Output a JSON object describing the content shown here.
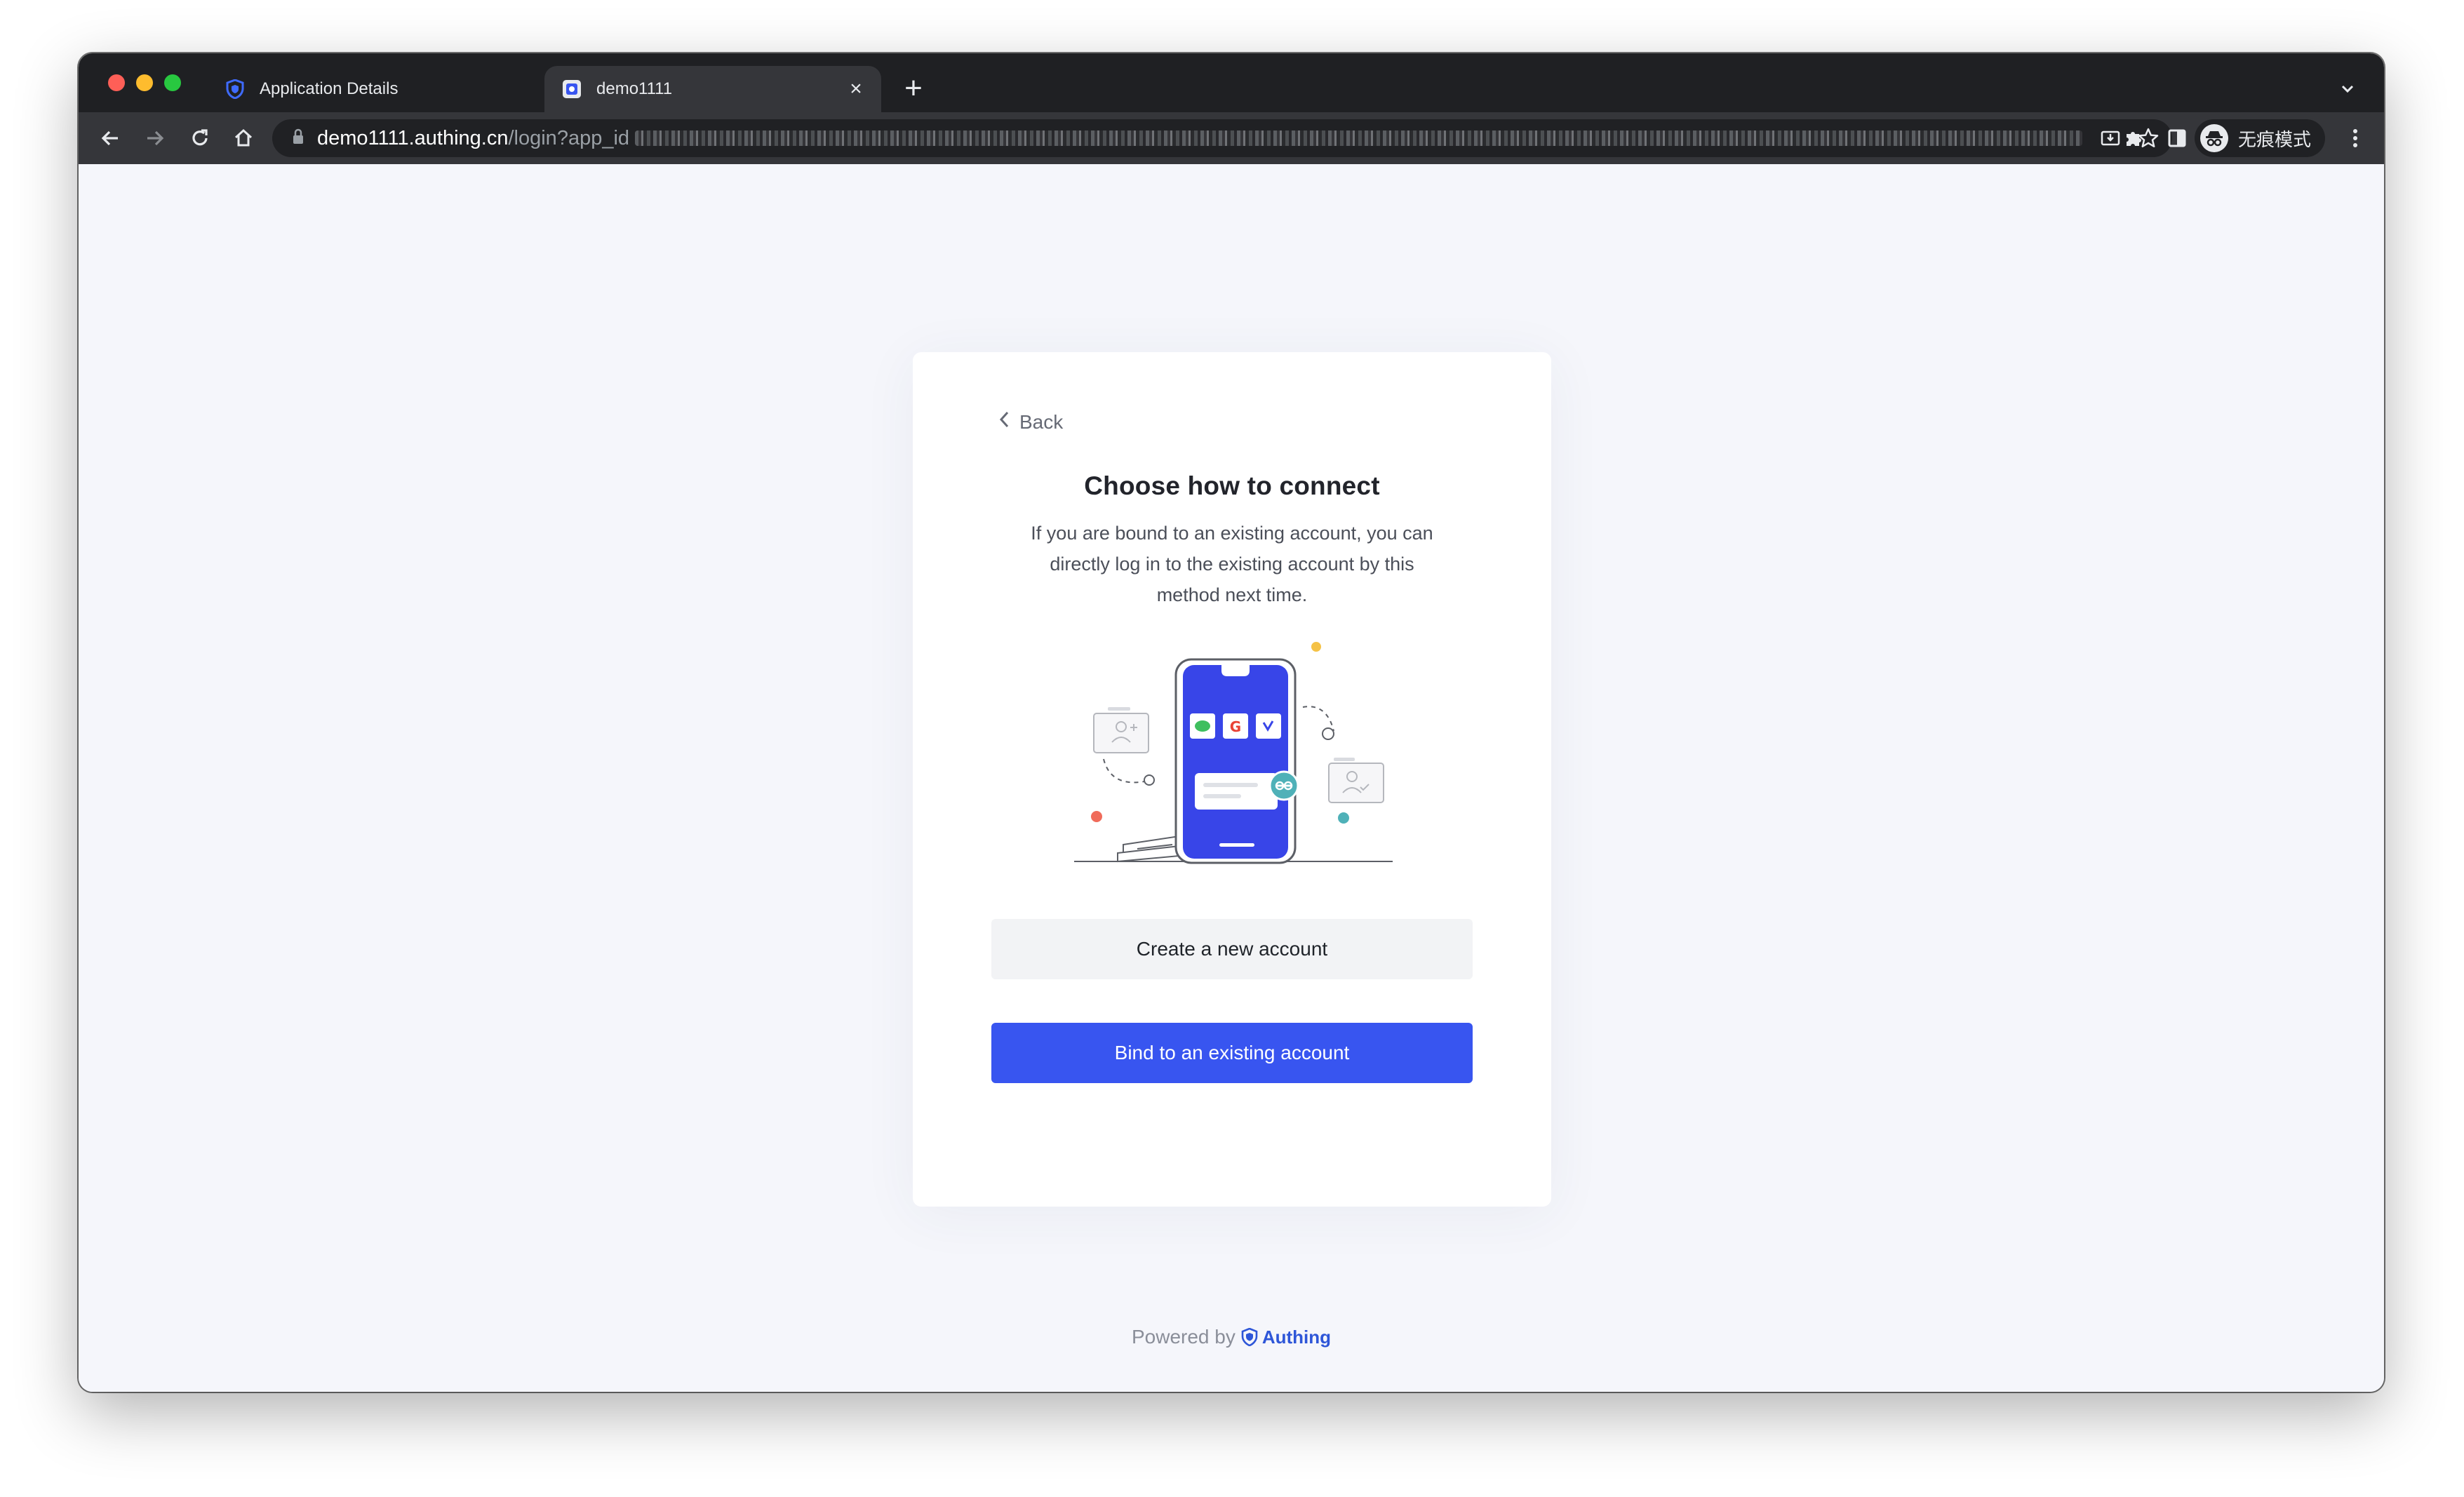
{
  "browser": {
    "tabs": [
      {
        "title": "Application Details",
        "active": false,
        "favicon": "authing-shield-icon"
      },
      {
        "title": "demo1111",
        "active": true,
        "favicon": "site-favicon"
      }
    ],
    "url_host": "demo1111.authing.cn",
    "url_path": "/login?app_id",
    "profile_label": "无痕模式",
    "icons": [
      "back-arrow-icon",
      "forward-arrow-icon",
      "reload-icon",
      "home-icon",
      "lock-icon",
      "install-app-icon",
      "star-icon",
      "extensions-icon",
      "side-panel-icon",
      "incognito-icon",
      "more-menu-icon"
    ]
  },
  "page": {
    "back_label": "Back",
    "title": "Choose how to connect",
    "description": "If you are bound to an existing account, you can directly log in to the existing account by this method next time.",
    "create_button": "Create a new account",
    "bind_button": "Bind to an existing account",
    "powered_by": "Powered by",
    "brand": "Authing"
  },
  "colors": {
    "primary": "#3855F0",
    "background": "#F5F6FB",
    "chrome_dark": "#1F2023"
  }
}
